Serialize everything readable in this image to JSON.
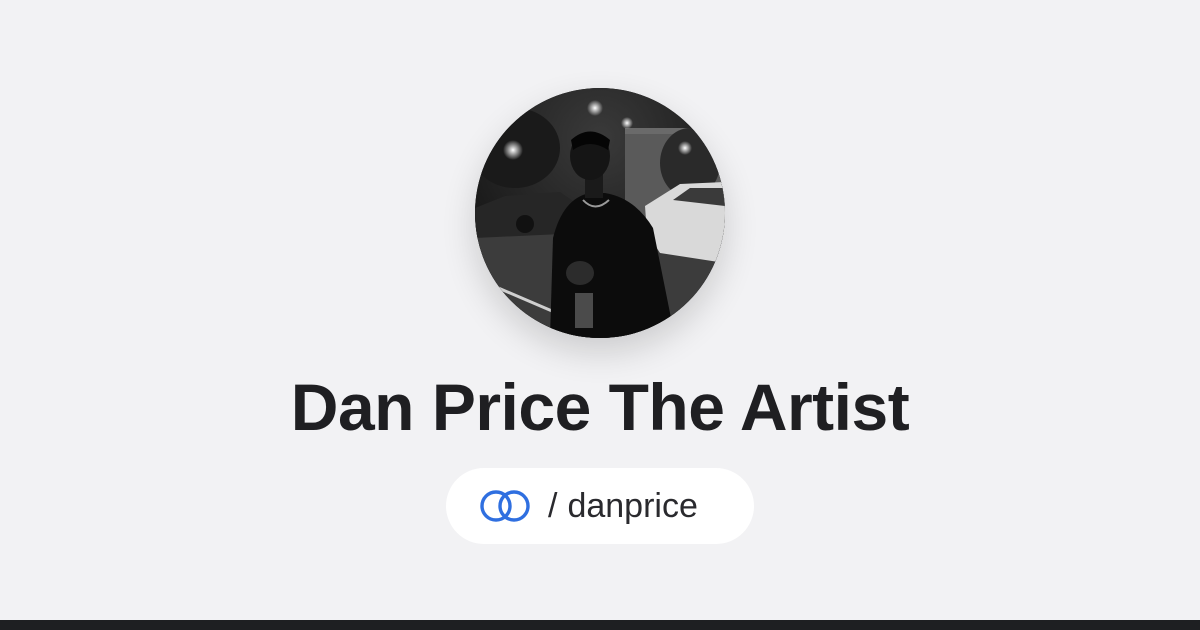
{
  "profile": {
    "display_name": "Dan Price The Artist",
    "handle_separator": "/",
    "handle": "danprice",
    "avatar_alt": "Profile photo"
  },
  "icons": {
    "link_icon": "linked-circles-icon"
  },
  "colors": {
    "background": "#f2f2f4",
    "title_text": "#1f1f22",
    "pill_background": "#ffffff",
    "accent_blue": "#2f6fe0",
    "bottom_bar": "#1e1f22"
  }
}
